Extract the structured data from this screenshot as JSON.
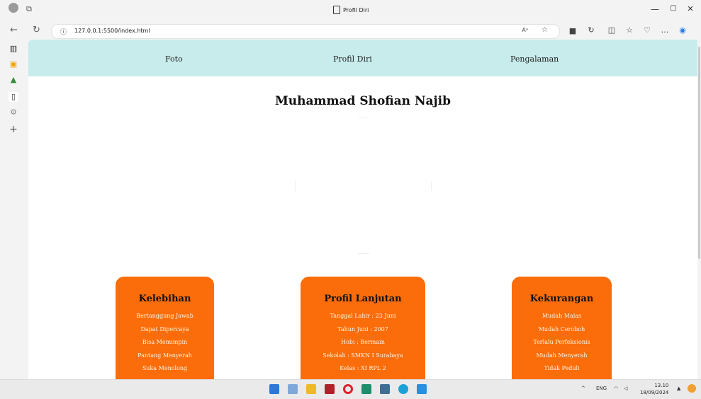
{
  "window": {
    "tab_title": "Profil Diri",
    "minimize": "—",
    "maximize": "▢",
    "close": "✕"
  },
  "address_bar": {
    "url": "127.0.0.1:5500/index.html",
    "info": "ⓘ",
    "reader": "Aᵃ",
    "favorite": "☆"
  },
  "nav": {
    "items": [
      "Foto",
      "Profil Diri",
      "Pengalaman"
    ]
  },
  "heading": "Muhammad Shofian Najib",
  "cards": [
    {
      "title": "Kelebihan",
      "items": [
        "Bertanggung Jawab",
        "Dapat Dipercaya",
        "Bisa Memimpin",
        "Pantang Menyerah",
        "Suka Menolong"
      ]
    },
    {
      "title": "Profil Lanjutan",
      "items": [
        "Tanggal Lahir : 23 Juni",
        "Tahun Juni : 2007",
        "Hobi : Bermain",
        "Sekolah : SMKN I Surabaya",
        "Kelas : XI RPL 2"
      ]
    },
    {
      "title": "Kekurangan",
      "items": [
        "Mudah Malas",
        "Mudah Ceroboh",
        "Terlalu Perfeksionis",
        "Mudah Menyerah",
        "Tidak Peduli"
      ]
    }
  ],
  "taskbar": {
    "language": "ENG",
    "time": "13.10",
    "date": "18/09/2024"
  },
  "colors": {
    "nav_bg": "#c8ecec",
    "card_bg": "#fb6d0a"
  }
}
